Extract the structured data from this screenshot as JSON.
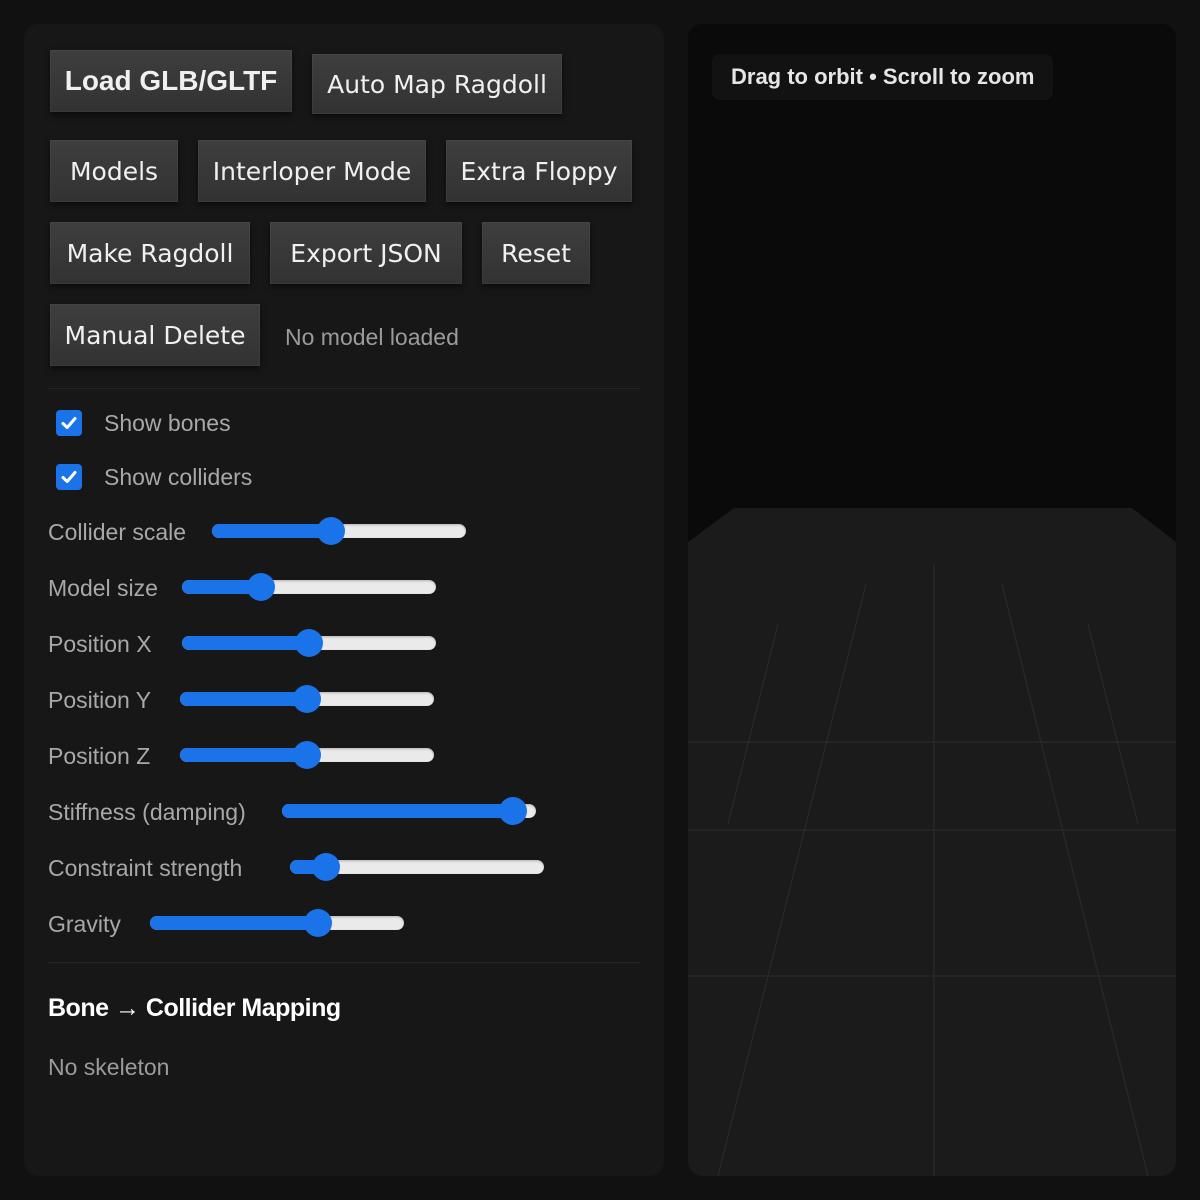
{
  "toolbar": {
    "load": "Load GLB/GLTF",
    "auto_map": "Auto Map Ragdoll",
    "models": "Models",
    "interloper": "Interloper Mode",
    "extra_floppy": "Extra Floppy",
    "make_ragdoll": "Make Ragdoll",
    "export_json": "Export JSON",
    "reset": "Reset",
    "manual_delete": "Manual Delete"
  },
  "status": "No model loaded",
  "toggles": {
    "show_bones": {
      "label": "Show bones",
      "checked": true
    },
    "show_colliders": {
      "label": "Show colliders",
      "checked": true
    }
  },
  "sliders": {
    "collider_scale": {
      "label": "Collider scale",
      "fraction": 0.47
    },
    "model_size": {
      "label": "Model size",
      "fraction": 0.31
    },
    "position_x": {
      "label": "Position X",
      "fraction": 0.5
    },
    "position_y": {
      "label": "Position Y",
      "fraction": 0.5
    },
    "position_z": {
      "label": "Position Z",
      "fraction": 0.5
    },
    "stiffness": {
      "label": "Stiffness (damping)",
      "fraction": 0.91
    },
    "constraint": {
      "label": "Constraint strength",
      "fraction": 0.14
    },
    "gravity": {
      "label": "Gravity",
      "fraction": 0.66
    }
  },
  "mapping": {
    "title": "Bone → Collider Mapping",
    "empty": "No skeleton"
  },
  "viewport": {
    "hint": "Drag to orbit • Scroll to zoom"
  },
  "colors": {
    "accent": "#1a73e8",
    "panel": "#171717",
    "background": "#111111"
  }
}
